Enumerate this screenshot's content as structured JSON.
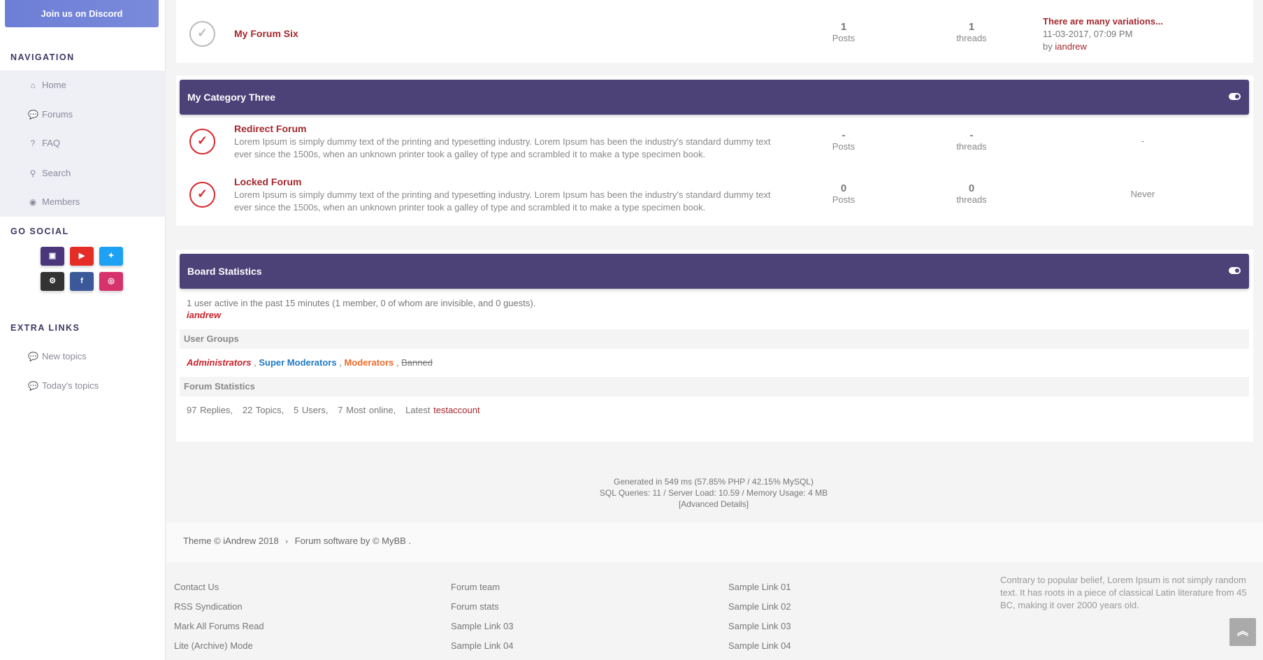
{
  "sidebar": {
    "discord_label": "Join us on Discord",
    "navigation_title": "NAVIGATION",
    "nav_items": [
      {
        "label": "Home",
        "icon": "home-icon"
      },
      {
        "label": "Forums",
        "icon": "comments-icon"
      },
      {
        "label": "FAQ",
        "icon": "question-icon"
      },
      {
        "label": "Search",
        "icon": "search-icon"
      },
      {
        "label": "Members",
        "icon": "user-circle-icon"
      }
    ],
    "social_title": "GO SOCIAL",
    "social": [
      {
        "name": "twitch",
        "color": "#4b367c"
      },
      {
        "name": "youtube",
        "color": "#e52d27"
      },
      {
        "name": "twitter",
        "color": "#1da1f2"
      },
      {
        "name": "steam",
        "color": "#333333"
      },
      {
        "name": "facebook",
        "color": "#3b5998"
      },
      {
        "name": "instagram",
        "color": "#d6336c"
      }
    ],
    "extra_title": "EXTRA LINKS",
    "extra_links": [
      "New topics",
      "Today's topics"
    ]
  },
  "forum_six": {
    "title": "My Forum Six",
    "posts": "1",
    "posts_label": "Posts",
    "threads": "1",
    "threads_label": "threads",
    "last_title": "There are many variations...",
    "last_date": "11-03-2017, 07:09 PM",
    "last_by": "by",
    "last_user": "iandrew"
  },
  "category_three": {
    "title": "My Category Three",
    "forums": [
      {
        "title": "Redirect Forum",
        "desc": "Lorem Ipsum is simply dummy text of the printing and typesetting industry. Lorem Ipsum has been the industry's standard dummy text ever since the 1500s, when an unknown printer took a galley of type and scrambled it to make a type specimen book.",
        "posts": "-",
        "posts_label": "Posts",
        "threads": "-",
        "threads_label": "threads",
        "last": "-"
      },
      {
        "title": "Locked Forum",
        "desc": "Lorem Ipsum is simply dummy text of the printing and typesetting industry. Lorem Ipsum has been the industry's standard dummy text ever since the 1500s, when an unknown printer took a galley of type and scrambled it to make a type specimen book.",
        "posts": "0",
        "posts_label": "Posts",
        "threads": "0",
        "threads_label": "threads",
        "last": "Never"
      }
    ]
  },
  "board_stats": {
    "title": "Board Statistics",
    "active_text": "1 user active in the past 15 minutes (1 member, 0 of whom are invisible, and 0 guests).",
    "active_user": "iandrew",
    "groups_title": "User Groups",
    "groups": {
      "admins": "Administrators",
      "supermods": "Super Moderators",
      "mods": "Moderators",
      "banned": "Banned",
      "sep": ","
    },
    "forum_stats_title": "Forum Statistics",
    "stats": {
      "replies": "97 Replies,",
      "topics": "22 Topics,",
      "users": "5 Users,",
      "most": "7 Most online,",
      "latest_label": "Latest",
      "latest_user": "testaccount"
    }
  },
  "debug": {
    "line1": "Generated in 549 ms (57.85% PHP / 42.15% MySQL)",
    "line2": "SQL Queries: 11 / Server Load: 10.59 / Memory Usage: 4 MB",
    "advanced": "[Advanced Details]"
  },
  "copyright": {
    "theme": "Theme © iAndrew 2018",
    "sep": "›",
    "software": "Forum software by © MyBB ."
  },
  "footer": {
    "col1": [
      "Contact Us",
      "RSS Syndication",
      "Mark All Forums Read",
      "Lite (Archive) Mode"
    ],
    "col2": [
      "Forum team",
      "Forum stats",
      "Sample Link 03",
      "Sample Link 04"
    ],
    "col3": [
      "Sample Link 01",
      "Sample Link 02",
      "Sample Link 03",
      "Sample Link 04"
    ],
    "about": "Contrary to popular belief, Lorem Ipsum is not simply random text. It has roots in a piece of classical Latin literature from 45 BC, making it over 2000 years old."
  }
}
